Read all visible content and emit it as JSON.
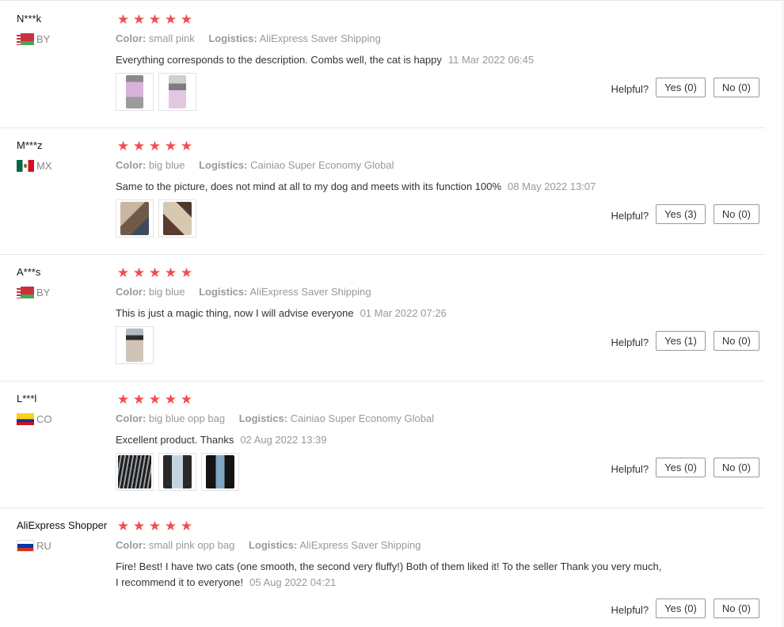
{
  "reviews": [
    {
      "user": "N***k",
      "country": "BY",
      "stars": 5,
      "color_key": "Color:",
      "color_value": "small pink",
      "logistics_key": "Logistics:",
      "logistics_value": "AliExpress Saver Shipping",
      "text": "Everything corresponds to the description. Combs well, the cat is happy",
      "date": "11 Mar 2022 06:45",
      "helpful_label": "Helpful?",
      "yes_label": "Yes (0)",
      "no_label": "No (0)",
      "images": 2
    },
    {
      "user": "M***z",
      "country": "MX",
      "stars": 5,
      "color_key": "Color:",
      "color_value": "big blue",
      "logistics_key": "Logistics:",
      "logistics_value": "Cainiao Super Economy Global",
      "text": "Same to the picture, does not mind at all to my dog and meets with its function 100%",
      "date": "08 May 2022 13:07",
      "helpful_label": "Helpful?",
      "yes_label": "Yes (3)",
      "no_label": "No (0)",
      "images": 2
    },
    {
      "user": "A***s",
      "country": "BY",
      "stars": 5,
      "color_key": "Color:",
      "color_value": "big blue",
      "logistics_key": "Logistics:",
      "logistics_value": "AliExpress Saver Shipping",
      "text": "This is just a magic thing, now I will advise everyone",
      "date": "01 Mar 2022 07:26",
      "helpful_label": "Helpful?",
      "yes_label": "Yes (1)",
      "no_label": "No (0)",
      "images": 1
    },
    {
      "user": "L***l",
      "country": "CO",
      "stars": 5,
      "color_key": "Color:",
      "color_value": "big blue opp bag",
      "logistics_key": "Logistics:",
      "logistics_value": "Cainiao Super Economy Global",
      "text": "Excellent product. Thanks",
      "date": "02 Aug 2022 13:39",
      "helpful_label": "Helpful?",
      "yes_label": "Yes (0)",
      "no_label": "No (0)",
      "images": 3
    },
    {
      "user": "AliExpress Shopper",
      "country": "RU",
      "stars": 5,
      "color_key": "Color:",
      "color_value": "small pink opp bag",
      "logistics_key": "Logistics:",
      "logistics_value": "AliExpress Saver Shipping",
      "text": "Fire! Best! I have two cats (one smooth, the second very fluffy!) Both of them liked it! To the seller Thank you very much, I recommend it to everyone!",
      "date": "05 Aug 2022 04:21",
      "helpful_label": "Helpful?",
      "yes_label": "Yes (0)",
      "no_label": "No (0)",
      "images": 0
    }
  ],
  "star_glyph": "★",
  "colors": {
    "star": "#f24d4d",
    "meta_text": "#999999",
    "border": "#e8e8e8"
  }
}
